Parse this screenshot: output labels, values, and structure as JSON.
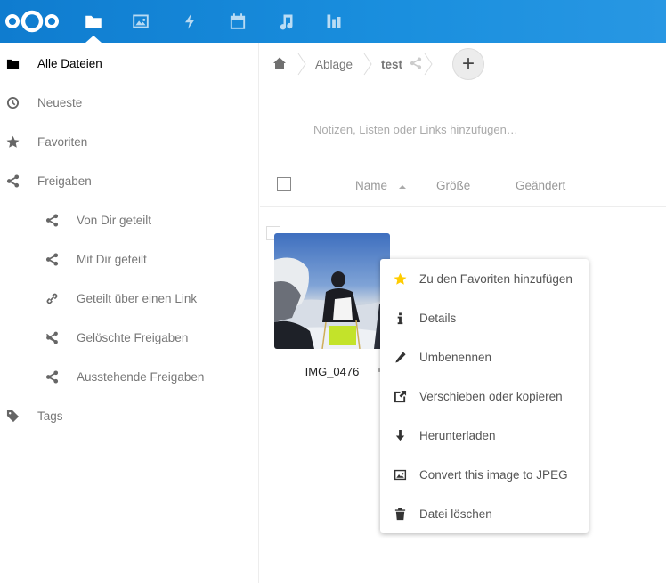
{
  "header": {
    "apps": [
      {
        "name": "files",
        "icon": "folder-icon",
        "active": true
      },
      {
        "name": "photos",
        "icon": "image-icon",
        "active": false
      },
      {
        "name": "activity",
        "icon": "lightning-icon",
        "active": false
      },
      {
        "name": "calendar",
        "icon": "calendar-icon",
        "active": false
      },
      {
        "name": "music",
        "icon": "music-note-icon",
        "active": false
      },
      {
        "name": "analytics",
        "icon": "bar-chart-icon",
        "active": false
      }
    ],
    "accent_color": "#0f7ccf"
  },
  "sidebar": {
    "items": [
      {
        "label": "Alle Dateien",
        "icon": "folder-icon",
        "active": true
      },
      {
        "label": "Neueste",
        "icon": "clock-icon"
      },
      {
        "label": "Favoriten",
        "icon": "star-icon"
      },
      {
        "label": "Freigaben",
        "icon": "share-icon"
      },
      {
        "label": "Von Dir geteilt",
        "icon": "share-icon"
      },
      {
        "label": "Mit Dir geteilt",
        "icon": "share-icon"
      },
      {
        "label": "Geteilt über einen Link",
        "icon": "link-icon"
      },
      {
        "label": "Gelöschte Freigaben",
        "icon": "deleted-share-icon"
      },
      {
        "label": "Ausstehende Freigaben",
        "icon": "share-icon"
      },
      {
        "label": "Tags",
        "icon": "tag-icon"
      }
    ]
  },
  "breadcrumb": {
    "items": [
      "Ablage",
      "test"
    ],
    "new_button_label": "+"
  },
  "notes": {
    "placeholder": "Notizen, Listen oder Links hinzufügen…"
  },
  "file_list": {
    "columns": {
      "name": "Name",
      "size": "Größe",
      "modified": "Geändert"
    },
    "sort": "name-ascending",
    "files": [
      {
        "name": "IMG_0476",
        "type": "image"
      }
    ]
  },
  "context_menu": {
    "items": [
      {
        "label": "Zu den Favoriten hinzufügen",
        "icon": "star-icon",
        "icon_color": "#fc0"
      },
      {
        "label": "Details",
        "icon": "info-icon"
      },
      {
        "label": "Umbenennen",
        "icon": "pencil-icon"
      },
      {
        "label": "Verschieben oder kopieren",
        "icon": "external-move-icon"
      },
      {
        "label": "Herunterladen",
        "icon": "download-icon"
      },
      {
        "label": "Convert this image to JPEG",
        "icon": "image-icon"
      },
      {
        "label": "Datei löschen",
        "icon": "trash-icon"
      }
    ]
  }
}
